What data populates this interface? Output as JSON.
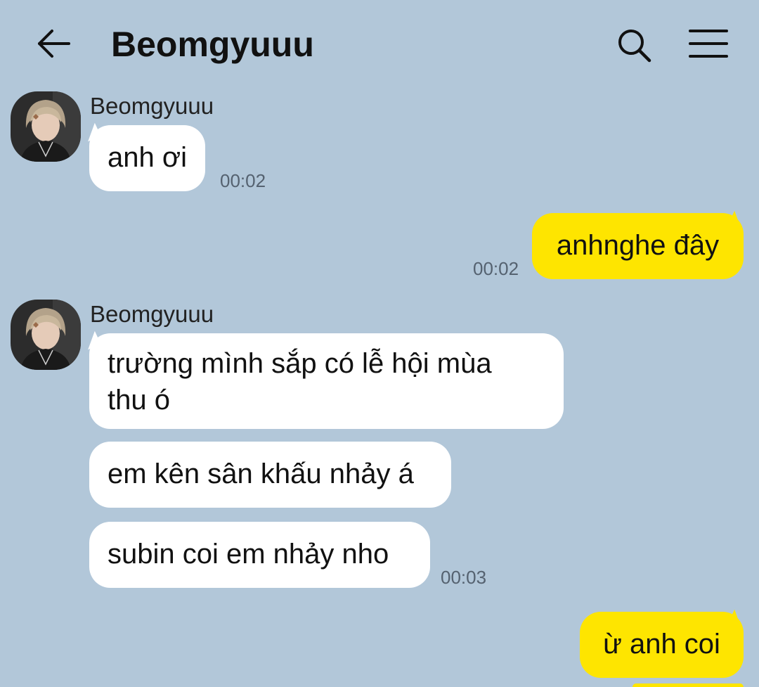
{
  "header": {
    "title": "Beomgyuuu",
    "back_icon": "arrow-left-icon",
    "search_icon": "search-icon",
    "menu_icon": "hamburger-menu-icon"
  },
  "colors": {
    "background": "#b2c7d9",
    "incoming_bubble": "#ffffff",
    "outgoing_bubble": "#fee500",
    "timestamp": "#556270"
  },
  "messages": [
    {
      "direction": "incoming",
      "sender": "Beomgyuuu",
      "text": "anh ơi",
      "time": "00:02"
    },
    {
      "direction": "outgoing",
      "text": "anhnghe đây",
      "time": "00:02"
    },
    {
      "direction": "incoming",
      "sender": "Beomgyuuu",
      "text": "trường mình sắp có lễ hội mùa thu ó"
    },
    {
      "direction": "incoming",
      "text": "em kên sân khấu nhảy á"
    },
    {
      "direction": "incoming",
      "text": "subin coi em nhảy nho",
      "time": "00:03"
    },
    {
      "direction": "outgoing",
      "text": "ừ anh coi"
    }
  ]
}
